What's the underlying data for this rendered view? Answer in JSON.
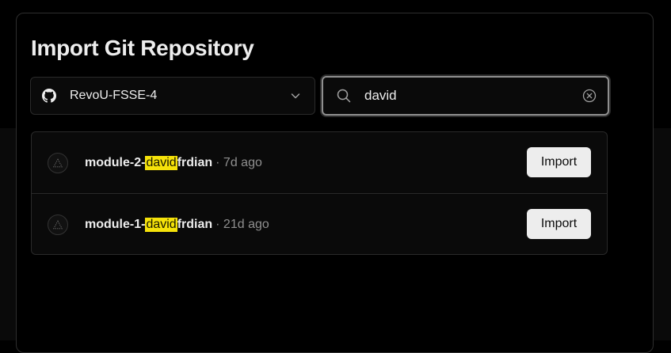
{
  "dialog": {
    "title": "Import Git Repository"
  },
  "scope": {
    "selected": "RevoU-FSSE-4",
    "icon": "github-icon"
  },
  "search": {
    "value": "david"
  },
  "repos": [
    {
      "prefix": "module-2-",
      "highlight": "david",
      "suffix": "frdian",
      "meta": "· 7d ago",
      "button": "Import"
    },
    {
      "prefix": "module-1-",
      "highlight": "david",
      "suffix": "frdian",
      "meta": "· 21d ago",
      "button": "Import"
    }
  ],
  "colors": {
    "highlight": "#f5e20a",
    "background": "#000000",
    "button": "#ededed"
  }
}
